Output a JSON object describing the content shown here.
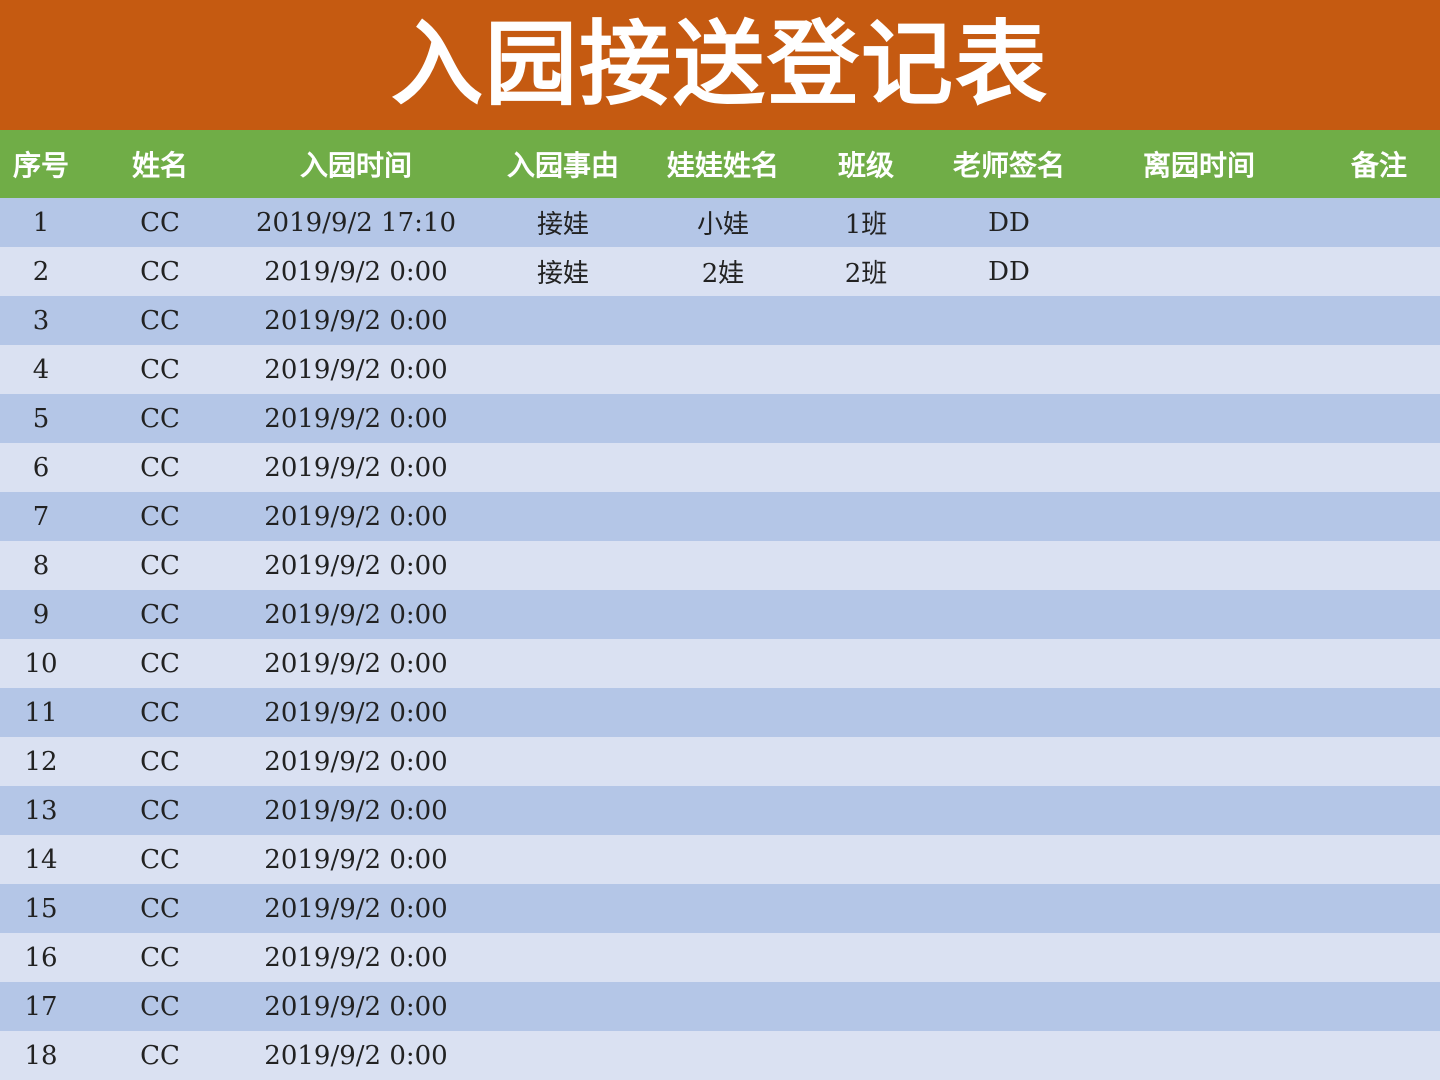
{
  "title": "入园接送登记表",
  "colors": {
    "title_bg": "#c55a11",
    "header_bg": "#70ad47",
    "row_odd": "#b4c6e7",
    "row_even": "#dae1f2"
  },
  "headers": [
    "序号",
    "姓名",
    "入园时间",
    "入园事由",
    "娃娃姓名",
    "班级",
    "老师签名",
    "离园时间",
    "备注"
  ],
  "rows": [
    [
      "1",
      "CC",
      "2019/9/2 17:10",
      "接娃",
      "小娃",
      "1班",
      "DD",
      "",
      ""
    ],
    [
      "2",
      "CC",
      "2019/9/2 0:00",
      "接娃",
      "2娃",
      "2班",
      "DD",
      "",
      ""
    ],
    [
      "3",
      "CC",
      "2019/9/2 0:00",
      "",
      "",
      "",
      "",
      "",
      ""
    ],
    [
      "4",
      "CC",
      "2019/9/2 0:00",
      "",
      "",
      "",
      "",
      "",
      ""
    ],
    [
      "5",
      "CC",
      "2019/9/2 0:00",
      "",
      "",
      "",
      "",
      "",
      ""
    ],
    [
      "6",
      "CC",
      "2019/9/2 0:00",
      "",
      "",
      "",
      "",
      "",
      ""
    ],
    [
      "7",
      "CC",
      "2019/9/2 0:00",
      "",
      "",
      "",
      "",
      "",
      ""
    ],
    [
      "8",
      "CC",
      "2019/9/2 0:00",
      "",
      "",
      "",
      "",
      "",
      ""
    ],
    [
      "9",
      "CC",
      "2019/9/2 0:00",
      "",
      "",
      "",
      "",
      "",
      ""
    ],
    [
      "10",
      "CC",
      "2019/9/2 0:00",
      "",
      "",
      "",
      "",
      "",
      ""
    ],
    [
      "11",
      "CC",
      "2019/9/2 0:00",
      "",
      "",
      "",
      "",
      "",
      ""
    ],
    [
      "12",
      "CC",
      "2019/9/2 0:00",
      "",
      "",
      "",
      "",
      "",
      ""
    ],
    [
      "13",
      "CC",
      "2019/9/2 0:00",
      "",
      "",
      "",
      "",
      "",
      ""
    ],
    [
      "14",
      "CC",
      "2019/9/2 0:00",
      "",
      "",
      "",
      "",
      "",
      ""
    ],
    [
      "15",
      "CC",
      "2019/9/2 0:00",
      "",
      "",
      "",
      "",
      "",
      ""
    ],
    [
      "16",
      "CC",
      "2019/9/2 0:00",
      "",
      "",
      "",
      "",
      "",
      ""
    ],
    [
      "17",
      "CC",
      "2019/9/2 0:00",
      "",
      "",
      "",
      "",
      "",
      ""
    ],
    [
      "18",
      "CC",
      "2019/9/2 0:00",
      "",
      "",
      "",
      "",
      "",
      ""
    ]
  ]
}
